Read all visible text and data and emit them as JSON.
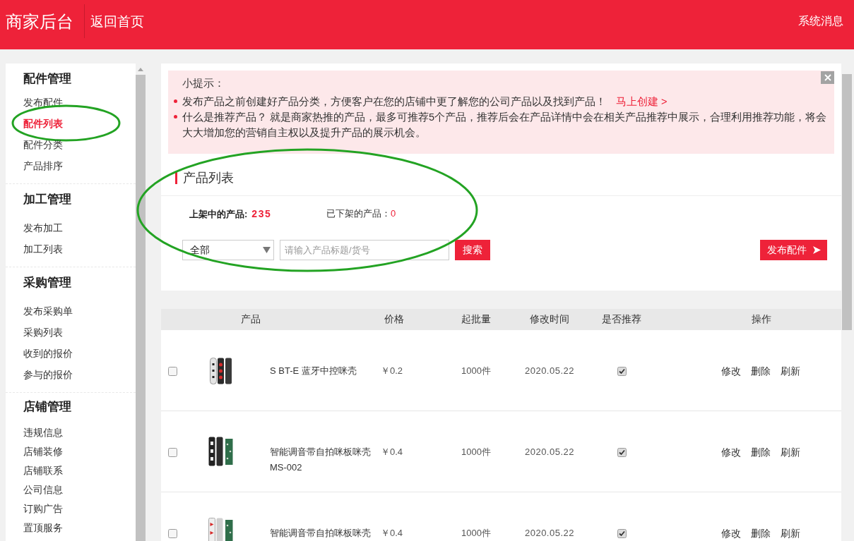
{
  "header": {
    "title": "商家后台",
    "back_link": "返回首页",
    "messages_link": "系统消息"
  },
  "sidebar": {
    "groups": [
      {
        "title": "配件管理",
        "items": [
          {
            "label": "发布配件",
            "selected": false,
            "circled": false
          },
          {
            "label": "配件列表",
            "selected": true,
            "circled": true
          },
          {
            "label": "配件分类",
            "selected": false,
            "circled": false
          },
          {
            "label": "产品排序",
            "selected": false,
            "circled": false
          }
        ]
      },
      {
        "title": "加工管理",
        "items": [
          {
            "label": "发布加工",
            "selected": false,
            "circled": false
          },
          {
            "label": "加工列表",
            "selected": false,
            "circled": false
          }
        ]
      },
      {
        "title": "采购管理",
        "items": [
          {
            "label": "发布采购单",
            "selected": false,
            "circled": false
          },
          {
            "label": "采购列表",
            "selected": false,
            "circled": false
          },
          {
            "label": "收到的报价",
            "selected": false,
            "circled": false
          },
          {
            "label": "参与的报价",
            "selected": false,
            "circled": false
          }
        ]
      },
      {
        "title": "店铺管理",
        "items": [
          {
            "label": "违规信息",
            "selected": false,
            "circled": false
          },
          {
            "label": "店铺装修",
            "selected": false,
            "circled": false
          },
          {
            "label": "店铺联系",
            "selected": false,
            "circled": false
          },
          {
            "label": "公司信息",
            "selected": false,
            "circled": false
          },
          {
            "label": "订购广告",
            "selected": false,
            "circled": false
          },
          {
            "label": "置顶服务",
            "selected": false,
            "circled": false
          }
        ]
      }
    ]
  },
  "tips": {
    "title": "小提示：",
    "items": [
      {
        "text": "发布产品之前创建好产品分类，方便客户在您的店铺中更了解您的公司产品以及找到产品！",
        "link": "马上创建 >"
      },
      {
        "text": "什么是推荐产品？ 就是商家热推的产品，最多可推荐5个产品，推荐后会在产品详情中会在相关产品推荐中展示，合理利用推荐功能，将会大大增加您的营销自主权以及提升产品的展示机会。"
      }
    ]
  },
  "product_list": {
    "title": "产品列表",
    "circled": true,
    "stats": [
      {
        "label": "上架中的产品:",
        "value": "235",
        "kind": "bold"
      },
      {
        "label": "已下架的产品：",
        "value": "0",
        "kind": "normal"
      }
    ],
    "filter": {
      "value": "全部"
    },
    "search": {
      "placeholder": "请输入产品标题/货号"
    },
    "search_button": "搜索",
    "publish_button": "发布配件"
  },
  "table": {
    "columns": [
      "产品",
      "价格",
      "起批量",
      "修改时间",
      "是否推荐",
      "操作"
    ],
    "rows": [
      {
        "checked": false,
        "name": "S BT-E 蓝牙中控咪壳",
        "price": "￥0.2",
        "min_order": "1000件",
        "modified": "2020.05.22",
        "recommended": true,
        "actions": [
          "修改",
          "删除",
          "刷新"
        ]
      },
      {
        "checked": false,
        "name": "智能调音带自拍咪板咪壳MS-002",
        "price": "￥0.4",
        "min_order": "1000件",
        "modified": "2020.05.22",
        "recommended": true,
        "actions": [
          "修改",
          "删除",
          "刷新"
        ]
      },
      {
        "checked": false,
        "name": "智能调音带自拍咪板咪壳",
        "price": "￥0.4",
        "min_order": "1000件",
        "modified": "2020.05.22",
        "recommended": true,
        "actions": [
          "修改",
          "删除",
          "刷新"
        ]
      }
    ]
  }
}
